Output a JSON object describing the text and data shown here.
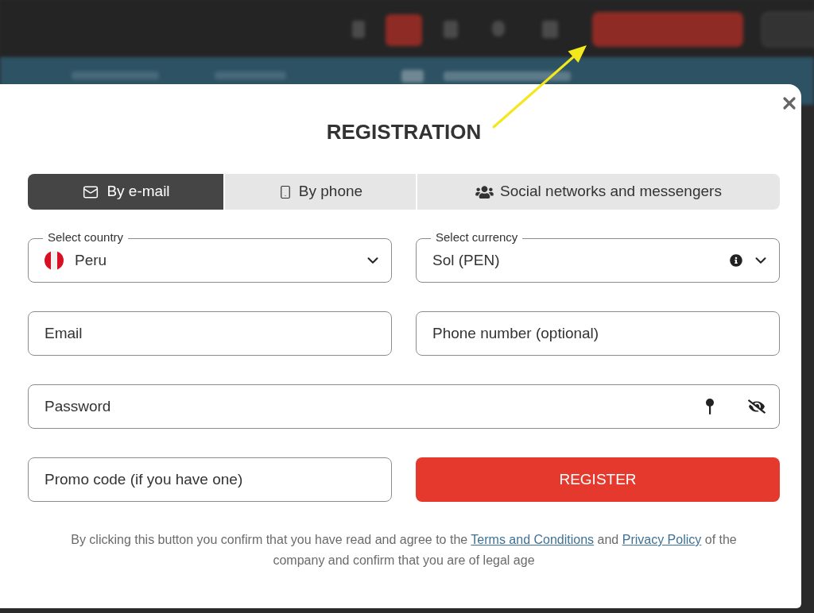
{
  "dialog": {
    "title": "REGISTRATION"
  },
  "tabs": [
    {
      "label": "By e-mail",
      "selected": true,
      "kind": "email"
    },
    {
      "label": "By phone",
      "selected": false,
      "kind": "phone"
    },
    {
      "label": "Social networks and messengers",
      "selected": false,
      "kind": "social"
    }
  ],
  "country_select": {
    "label": "Select country",
    "value": "Peru"
  },
  "currency_select": {
    "label": "Select currency",
    "value": "Sol (PEN)"
  },
  "email_field": {
    "placeholder": "Email"
  },
  "phone_field": {
    "placeholder": "Phone number (optional)"
  },
  "password_field": {
    "placeholder": "Password"
  },
  "promo_field": {
    "placeholder": "Promo code (if you have one)"
  },
  "register_button": {
    "label": "REGISTER"
  },
  "consent": {
    "text_before": "By clicking this button you confirm that you have read and agree to the",
    "terms_link": "Terms and Conditions",
    "text_middle": "and",
    "privacy_link": "Privacy Policy",
    "text_after": "of the company and confirm that you are of legal age"
  }
}
